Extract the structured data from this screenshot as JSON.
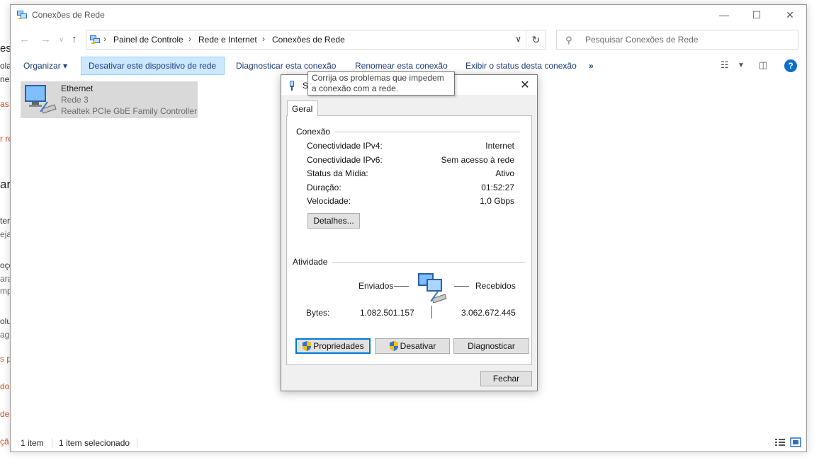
{
  "background": {
    "fragments": [
      "est",
      "ola",
      "nex",
      "as p",
      "r re",
      "ar",
      "ter",
      "eja",
      "oçõ",
      "ara",
      "mp",
      "olu",
      "agr",
      "s p",
      "do",
      "de",
      "çã"
    ]
  },
  "window": {
    "title": "Conexões de Rede",
    "breadcrumbs": [
      "Painel de Controle",
      "Rede e Internet",
      "Conexões de Rede"
    ],
    "search_placeholder": "Pesquisar Conexões de Rede"
  },
  "commandbar": {
    "organize": "Organizar ▾",
    "disable": "Desativar este dispositivo de rede",
    "diagnose": "Diagnosticar esta conexão",
    "rename": "Renomear esta conexão",
    "status": "Exibir o status desta conexão",
    "more": "»"
  },
  "items": [
    {
      "name": "Ethernet",
      "network": "Rede 3",
      "adapter": "Realtek PCIe GbE Family Controller"
    }
  ],
  "statusbar": {
    "count": "1 item",
    "selected": "1 item selecionado"
  },
  "tooltip": "Corrija os problemas que impedem a conexão com a rede.",
  "dialog": {
    "title": "S",
    "tab": "Geral",
    "connection_label": "Conexão",
    "rows": [
      {
        "k": "Conectividade IPv4:",
        "v": "Internet"
      },
      {
        "k": "Conectividade IPv6:",
        "v": "Sem acesso à rede"
      },
      {
        "k": "Status da Mídia:",
        "v": "Ativo"
      },
      {
        "k": "Duração:",
        "v": "01:52:27"
      },
      {
        "k": "Velocidade:",
        "v": "1,0 Gbps"
      }
    ],
    "details_btn": "Detalhes...",
    "activity_label": "Atividade",
    "sent_label": "Enviados",
    "received_label": "Recebidos",
    "bytes_label": "Bytes:",
    "bytes_sent": "1.082.501.157",
    "bytes_received": "3.062.672.445",
    "properties_btn": "Propriedades",
    "disable_btn": "Desativar",
    "diagnose_btn": "Diagnosticar",
    "close_btn": "Fechar"
  },
  "colors": {
    "link": "#1e3c78",
    "selection": "#cce8ff",
    "accent": "#0078d7",
    "settings_orange": "#c8531f"
  }
}
